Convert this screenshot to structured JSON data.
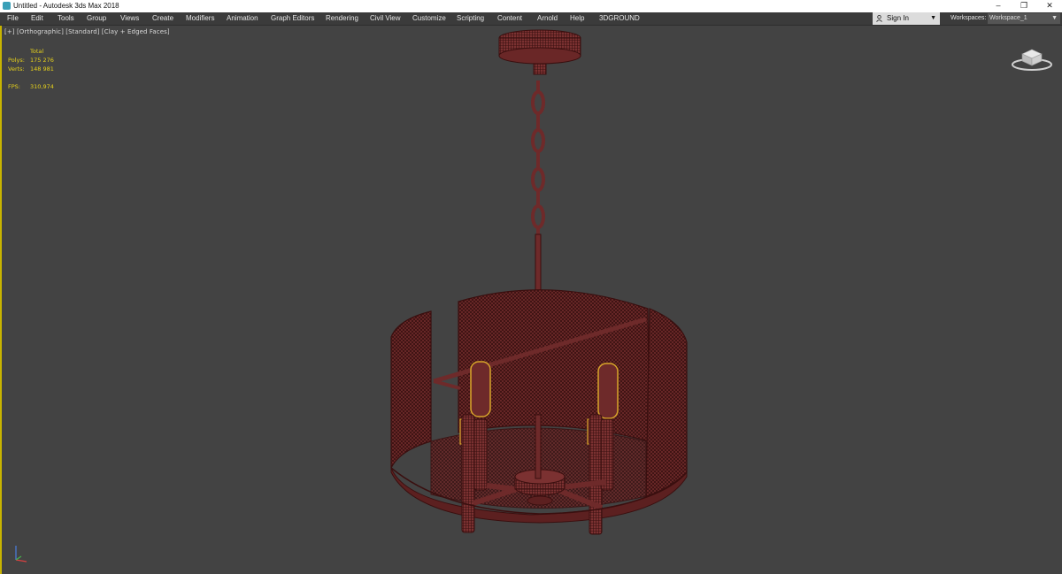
{
  "window": {
    "title": "Untitled - Autodesk 3ds Max 2018"
  },
  "menu": [
    "File",
    "Edit",
    "Tools",
    "Group",
    "Views",
    "Create",
    "Modifiers",
    "Animation",
    "Graph Editors",
    "Rendering",
    "Civil View",
    "Customize",
    "Scripting",
    "Content",
    "Arnold",
    "Help",
    "3DGROUND"
  ],
  "account": {
    "sign_in": "Sign In"
  },
  "workspaces": {
    "label": "Workspaces:",
    "value": "Workspace_1"
  },
  "viewport": {
    "label": "[+] [Orthographic] [Standard] [Clay + Edged Faces]",
    "stats": {
      "header": "Total",
      "polys_label": "Polys:",
      "polys": "175 276",
      "verts_label": "Verts:",
      "verts": "148 981",
      "fps_label": "FPS:",
      "fps": "310,974"
    }
  },
  "colors": {
    "model": "#7a2f2f",
    "wire": "#3a0f0f",
    "selected": "#d8a62a",
    "stats_text": "#e7d21b",
    "active_border": "#c8b400"
  },
  "icons": [
    "app-icon",
    "minimize-icon",
    "restore-icon",
    "close-icon",
    "user-icon",
    "chevron-down-icon",
    "viewcube-icon",
    "axis-tripod-icon"
  ]
}
